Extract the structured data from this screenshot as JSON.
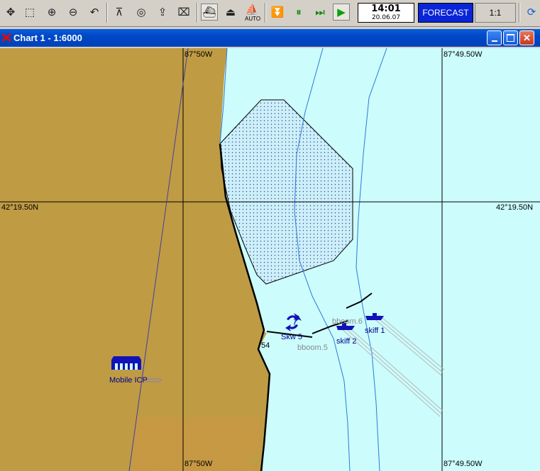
{
  "toolbar": {
    "buttons": [
      {
        "name": "pan-tool-icon",
        "glyph": "✥"
      },
      {
        "name": "zoom-window-icon",
        "glyph": "⬚"
      },
      {
        "name": "zoom-in-icon",
        "glyph": "⊕"
      },
      {
        "name": "zoom-out-icon",
        "glyph": "⊖"
      },
      {
        "name": "undo-view-icon",
        "glyph": "↶"
      },
      {
        "name": "measure-tool-icon",
        "glyph": "⊼"
      },
      {
        "name": "target-icon",
        "glyph": "◎"
      },
      {
        "name": "export-icon",
        "glyph": "⇪"
      },
      {
        "name": "clear-icon",
        "glyph": "⌧"
      },
      {
        "name": "ship-view-icon",
        "glyph": "⛴"
      },
      {
        "name": "vessel-icon",
        "glyph": "⏏"
      },
      {
        "name": "auto-mode-icon",
        "glyph": "⛵"
      },
      {
        "name": "stop-icon",
        "glyph": "⏬"
      },
      {
        "name": "pause-icon",
        "glyph": "⏸"
      },
      {
        "name": "fast-forward-icon",
        "glyph": "⏭"
      },
      {
        "name": "play-icon",
        "glyph": "▶"
      }
    ],
    "auto_label": "AUTO",
    "clock_time": "14:01",
    "clock_date": "20.06.07",
    "forecast_label": "FORECAST",
    "scale_label": "1:1"
  },
  "window": {
    "title": "Chart 1 - 1:6000"
  },
  "chart": {
    "coords": {
      "top_left_lon": "87°50W",
      "top_right_lon": "87°49.50W",
      "left_lat": "42°19.50N",
      "right_lat": "42°19.50N",
      "bottom_left_lon": "87°50W",
      "bottom_right_lon": "87°49.50W"
    },
    "labels": {
      "skw5": "Skw 5",
      "bboom5": "bboom.5",
      "bboom6": "bboom.6",
      "skiff1": "skiff 1",
      "skiff2": "skiff 2",
      "depth": "54",
      "mobile_icp": "Mobile ICP"
    },
    "colors": {
      "land": "#bf9b44",
      "water": "#ccfcfc",
      "spill": "#cef0fb",
      "units": "#1212b8",
      "accent": "#0a24d8"
    }
  }
}
